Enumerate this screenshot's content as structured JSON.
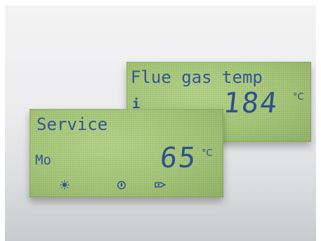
{
  "flue_display": {
    "title": "Flue gas temp",
    "info_symbol": "i",
    "value": "184",
    "unit": "°C"
  },
  "service_display": {
    "title": "Service",
    "mode": "Mo",
    "value": "65",
    "unit": "°C",
    "symbols": [
      "sun-icon",
      "flame-icon",
      "tap-icon"
    ]
  },
  "colors": {
    "lcd_background": "#a8c97c",
    "lcd_text": "#2f4f96",
    "backdrop": "#e4e5e8"
  }
}
